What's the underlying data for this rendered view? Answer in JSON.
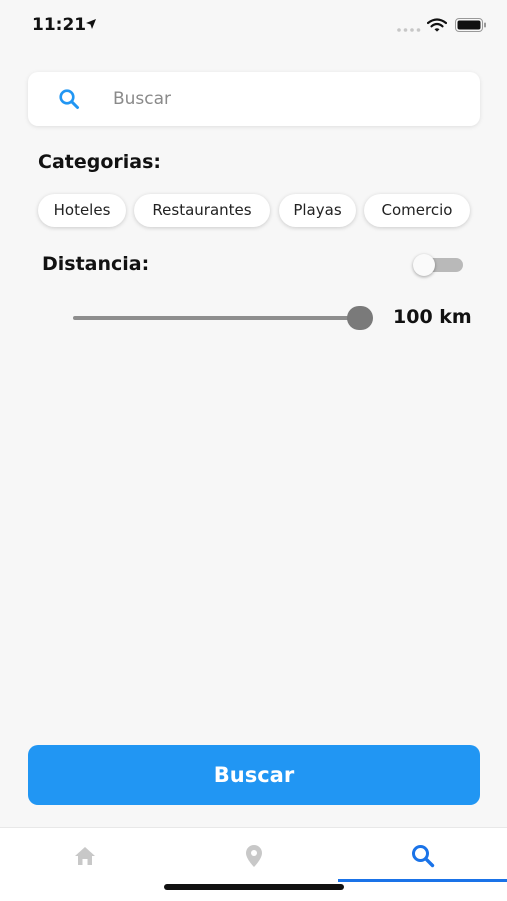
{
  "status_bar": {
    "time": "11:21",
    "icons": [
      "location-arrow-icon",
      "signal-dots-icon",
      "wifi-icon",
      "battery-icon"
    ]
  },
  "search": {
    "placeholder": "Buscar",
    "value": "",
    "icon": "search-icon"
  },
  "categories": {
    "title": "Categorias:",
    "items": [
      {
        "label": "Hoteles"
      },
      {
        "label": "Restaurantes"
      },
      {
        "label": "Playas"
      },
      {
        "label": "Comercio"
      }
    ]
  },
  "distance": {
    "title": "Distancia:",
    "toggle_enabled": false,
    "slider_fraction": 1,
    "value_label": "100 km"
  },
  "actions": {
    "search_button_label": "Buscar"
  },
  "tab_bar": {
    "items": [
      {
        "icon": "home-icon",
        "active": false
      },
      {
        "icon": "location-pin-icon",
        "active": false
      },
      {
        "icon": "search-icon",
        "active": true
      }
    ]
  },
  "colors": {
    "accent": "#2196f3",
    "tab_active": "#1a73e8",
    "tab_inactive": "#c8c8c8",
    "background": "#f7f7f7"
  }
}
